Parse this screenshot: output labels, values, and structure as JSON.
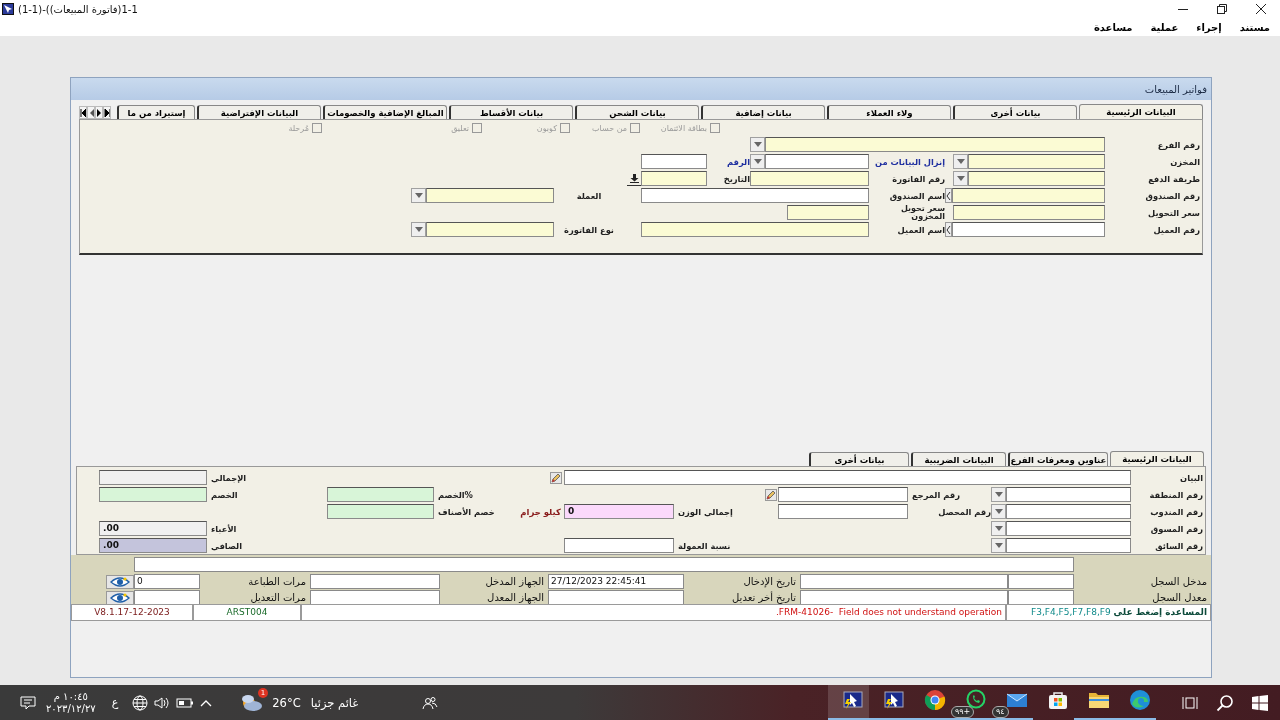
{
  "title_bar": {
    "title": "(1-1)-((فاتورة المبيعات)1-1"
  },
  "menu": [
    "مستند",
    "إجراء",
    "عملية",
    "مساعدة"
  ],
  "form": {
    "title": "فواتير المبيعات"
  },
  "top_tabs": [
    {
      "label": "البيانات الرئيسية",
      "selected": true
    },
    {
      "label": "بيانات أخرى",
      "selected": false
    },
    {
      "label": "ولاء العملاء",
      "selected": false
    },
    {
      "label": "بيانات إضافية",
      "selected": false
    },
    {
      "label": "بيانات الشحن",
      "selected": false
    },
    {
      "label": "بيانات الأقساط",
      "selected": false
    },
    {
      "label": "المبالغ الإضافية والخصومات",
      "selected": false
    },
    {
      "label": "البيانات الإفتراضية",
      "selected": false
    },
    {
      "label": "إستيراد من ما",
      "selected": false
    }
  ],
  "checkboxes": [
    {
      "label": "بطاقة الائتمان",
      "checked": false,
      "disabled": true
    },
    {
      "label": "من حساب",
      "checked": false,
      "disabled": true
    },
    {
      "label": "كوبون",
      "checked": false,
      "disabled": true
    },
    {
      "label": "تعليق",
      "checked": false,
      "disabled": true
    },
    {
      "label": "مُرحلة",
      "checked": false,
      "disabled": true
    }
  ],
  "main_fields": [
    {
      "label": "رقم الفرع",
      "kind": "dropdown",
      "required": true,
      "accent": false
    },
    {
      "label": "المخزن",
      "kind": "dropdown",
      "required": true,
      "accent": false
    },
    {
      "label": "إنزال البيانات من",
      "kind": "dropdown",
      "required": false,
      "accent": true
    },
    {
      "label": "الرقم",
      "kind": "text",
      "required": false,
      "accent": true
    },
    {
      "label": "طريقة الدفع",
      "kind": "dropdown",
      "required": true,
      "accent": false
    },
    {
      "label": "رقم الفاتورة",
      "kind": "text",
      "required": true,
      "accent": false
    },
    {
      "label": "التاريخ",
      "kind": "text",
      "required": true,
      "accent": false
    },
    {
      "label": "رقم الصندوق",
      "kind": "lov",
      "required": true,
      "accent": false
    },
    {
      "label": "اسم الصندوق",
      "kind": "text",
      "required": false,
      "accent": false
    },
    {
      "label": "العملة",
      "kind": "dropdown",
      "required": true,
      "accent": false
    },
    {
      "label": "سعر التحويل",
      "kind": "text",
      "required": true,
      "accent": false
    },
    {
      "label": "سعر تحويل المخزون",
      "kind": "text",
      "required": true,
      "accent": false
    },
    {
      "label": "رقم العميل",
      "kind": "lov",
      "required": false,
      "accent": false
    },
    {
      "label": "اسم العميل",
      "kind": "text",
      "required": true,
      "accent": false
    },
    {
      "label": "نوع الفاتورة",
      "kind": "dropdown",
      "required": true,
      "accent": false
    }
  ],
  "bottom_tabs": [
    {
      "label": "البيانات الرئيسية",
      "selected": true
    },
    {
      "label": "عناوين ومعرفات الفرع",
      "selected": false
    },
    {
      "label": "البيانات الضريبية",
      "selected": false
    },
    {
      "label": "بيانات أخرى",
      "selected": false
    }
  ],
  "bottom_fields": [
    {
      "label": "البيان",
      "kind": "edit",
      "required": false
    },
    {
      "label": "الإجمالي",
      "kind": "text",
      "color": "#f0f0f0"
    },
    {
      "label": "رقم المنطقة",
      "kind": "dropdown",
      "required": false
    },
    {
      "label": "رقم المرجع",
      "kind": "edit",
      "required": false
    },
    {
      "label": "%الخصم",
      "kind": "text",
      "color": "#d8f5d8"
    },
    {
      "label": "الخصم",
      "kind": "text",
      "color": "#d8f5d8"
    },
    {
      "label": "رقم المندوب",
      "kind": "dropdown",
      "required": false
    },
    {
      "label": "رقم المحصل",
      "kind": "text",
      "required": false
    },
    {
      "label": "إجمالي الوزن",
      "kind": "text",
      "color": "#fbd9fb",
      "value": "0",
      "unit": "كيلو جرام"
    },
    {
      "label": "خصم الأصناف",
      "kind": "text",
      "color": "#d8f5d8"
    },
    {
      "label": "رقم المسوق",
      "kind": "dropdown",
      "required": false
    },
    {
      "label": "الأعباء",
      "kind": "text",
      "color": "#f0f0f0",
      "value": ".00"
    },
    {
      "label": "رقم السائق",
      "kind": "dropdown",
      "required": false
    },
    {
      "label": "نسبة العمولة",
      "kind": "text",
      "required": false
    },
    {
      "label": "الصافي",
      "kind": "text",
      "color": "#c4c4dc",
      "value": ".00"
    }
  ],
  "record_rows": [
    {
      "label": "مدخل السجل",
      "date_label": "تاريخ الإدخال",
      "date": "27/12/2023 22:45:41",
      "device_label": "الجهاز المدخل",
      "count_label": "مرات الطباعة",
      "count": "0"
    },
    {
      "label": "معدل السجل",
      "date_label": "تاريخ أخر تعديل",
      "device_label": "الجهاز المعدل",
      "count_label": "مرات التعديل"
    }
  ],
  "status": {
    "help": "**المساعدة إضغط على** F3,F4,F5,F7,F8,F9",
    "message": "FRM-41026-  Field does not understand operation.",
    "user": "ARST004",
    "version": "V8.1.17-12-2023"
  },
  "taskbar": {
    "time": "١٠:٤٥ م",
    "date": "٢٠٢٣/١٢/٢٧",
    "language": "ع",
    "weather_badge": "1",
    "temperature": "26°C",
    "weather": "غائم جزئيا",
    "apps": [
      {
        "kind": "edge",
        "active": false,
        "running": true
      },
      {
        "kind": "folder",
        "active": false,
        "running": true
      },
      {
        "kind": "store",
        "active": false,
        "running": false
      },
      {
        "kind": "mail",
        "active": false,
        "running": true,
        "badge": "٩٤"
      },
      {
        "kind": "whatsapp",
        "active": false,
        "running": true,
        "badge": "٩٩+"
      },
      {
        "kind": "chrome",
        "active": false,
        "running": true
      },
      {
        "kind": "forms",
        "active": false,
        "running": true
      },
      {
        "kind": "forms",
        "active": true,
        "running": true
      }
    ]
  }
}
